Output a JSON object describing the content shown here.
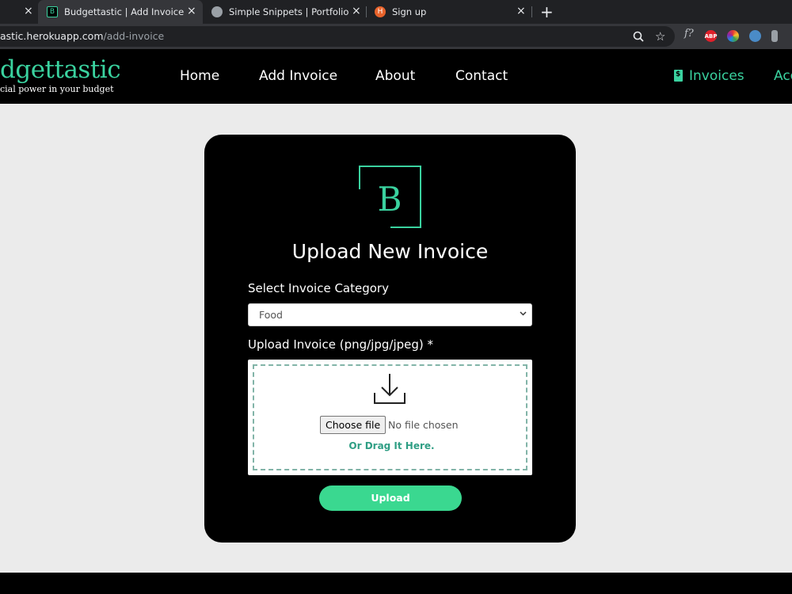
{
  "browser": {
    "tabs": [
      {
        "title": "",
        "close": "×"
      },
      {
        "title": "Budgettastic | Add Invoice",
        "favicon": "B",
        "close": "×"
      },
      {
        "title": "Simple Snippets | Portfolio",
        "favicon_icon": "globe-icon",
        "close": "×"
      },
      {
        "title": "Sign up",
        "favicon": "H",
        "close": "×"
      }
    ],
    "new_tab": "+",
    "url_main": "astic.herokuapp.com",
    "url_path": "/add-invoice",
    "extensions": {
      "abp": "ABP",
      "f": "f?"
    }
  },
  "site": {
    "brand": "dgettastic",
    "tagline": "cial power in your budget",
    "nav": [
      "Home",
      "Add Invoice",
      "About",
      "Contact"
    ],
    "invoices_link": "Invoices",
    "cut_link": "Acc",
    "accent": "#3ad29f"
  },
  "form": {
    "logo_letter": "B",
    "title": "Upload New Invoice",
    "category_label": "Select Invoice Category",
    "category_value": "Food",
    "upload_label": "Upload Invoice (png/jpg/jpeg) *",
    "choose_file": "Choose file",
    "no_file": "No file chosen",
    "drag_text": "Or Drag It Here.",
    "submit": "Upload"
  }
}
